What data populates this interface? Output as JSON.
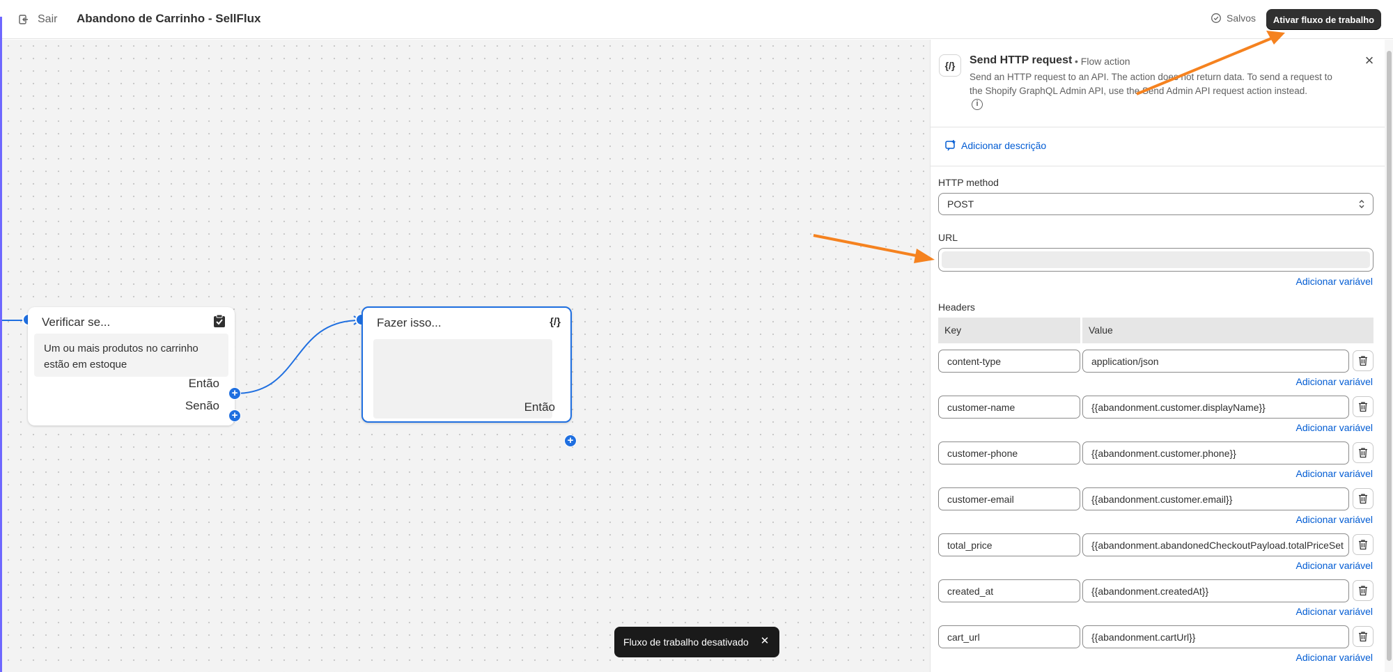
{
  "topbar": {
    "exit_label": "Sair",
    "title": "Abandono de Carrinho - SellFlux",
    "saved_label": "Salvos",
    "activate_label": "Ativar fluxo de trabalho"
  },
  "canvas": {
    "condition_node": {
      "title": "Verificar se...",
      "icon": "clipboard-check-icon",
      "condition": "Um ou mais produtos no carrinho estão em estoque",
      "then_label": "Então",
      "else_label": "Senão"
    },
    "action_node": {
      "title": "Fazer isso...",
      "icon_glyph": "{/}",
      "then_label": "Então"
    },
    "toast": "Fluxo de trabalho desativado"
  },
  "panel": {
    "icon_glyph": "{/}",
    "title": "Send HTTP request",
    "subtitle": "• Flow action",
    "description": "Send an HTTP request to an API. The action does not return data. To send a request to the Shopify GraphQL Admin API, use the Send Admin API request action instead.",
    "add_description": "Adicionar descrição",
    "http_method_label": "HTTP method",
    "http_method_value": "POST",
    "url_label": "URL",
    "url_value": "",
    "add_variable": "Adicionar variável",
    "headers_label": "Headers",
    "key_header": "Key",
    "value_header": "Value",
    "headers": [
      {
        "key": "content-type",
        "value": "application/json"
      },
      {
        "key": "customer-name",
        "value": "{{abandonment.customer.displayName}}"
      },
      {
        "key": "customer-phone",
        "value": "{{abandonment.customer.phone}}"
      },
      {
        "key": "customer-email",
        "value": "{{abandonment.customer.email}}"
      },
      {
        "key": "total_price",
        "value": "{{abandonment.abandonedCheckoutPayload.totalPriceSet"
      },
      {
        "key": "created_at",
        "value": "{{abandonment.createdAt}}"
      },
      {
        "key": "cart_url",
        "value": "{{abandonment.cartUrl}}"
      }
    ]
  },
  "colors": {
    "accent_blue": "#1f6fe0",
    "link_blue": "#005bd3",
    "annotation_orange": "#f5821f",
    "primary_button": "#303030"
  }
}
